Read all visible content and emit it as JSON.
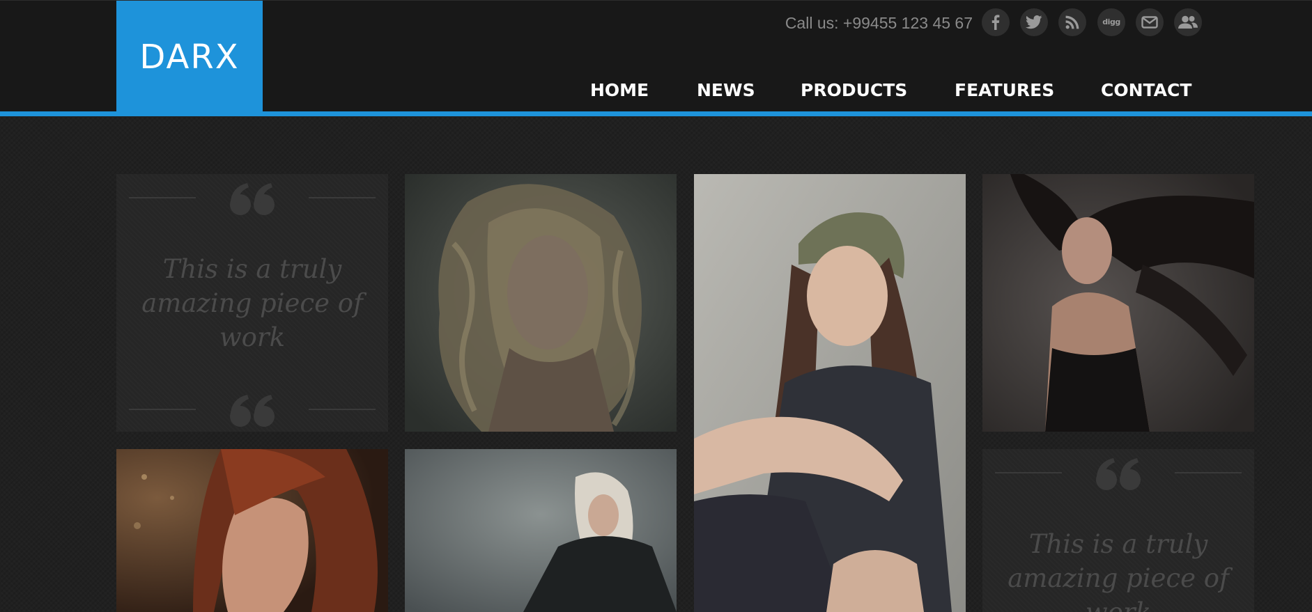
{
  "brand": {
    "logo_text": "DARX",
    "accent_color": "#1e93da"
  },
  "header": {
    "call_text": "Call us: +99455 123 45 67"
  },
  "social_icons": [
    "facebook-icon",
    "twitter-icon",
    "rss-icon",
    "digg-icon",
    "mail-icon",
    "users-icon"
  ],
  "social_labels": {
    "digg": "digg"
  },
  "nav": {
    "items": [
      {
        "label": "HOME"
      },
      {
        "label": "NEWS"
      },
      {
        "label": "PRODUCTS"
      },
      {
        "label": "FEATURES"
      },
      {
        "label": "CONTACT"
      }
    ]
  },
  "grid": {
    "quotes": [
      {
        "text": "This is a truly amazing piece of work"
      },
      {
        "text": "This is a truly amazing piece of work"
      }
    ],
    "photos": [
      "portrait-curly-hair-photo",
      "portrait-green-cap-photo",
      "portrait-flying-hair-photo",
      "portrait-red-hair-photo",
      "portrait-blonde-photo"
    ]
  }
}
